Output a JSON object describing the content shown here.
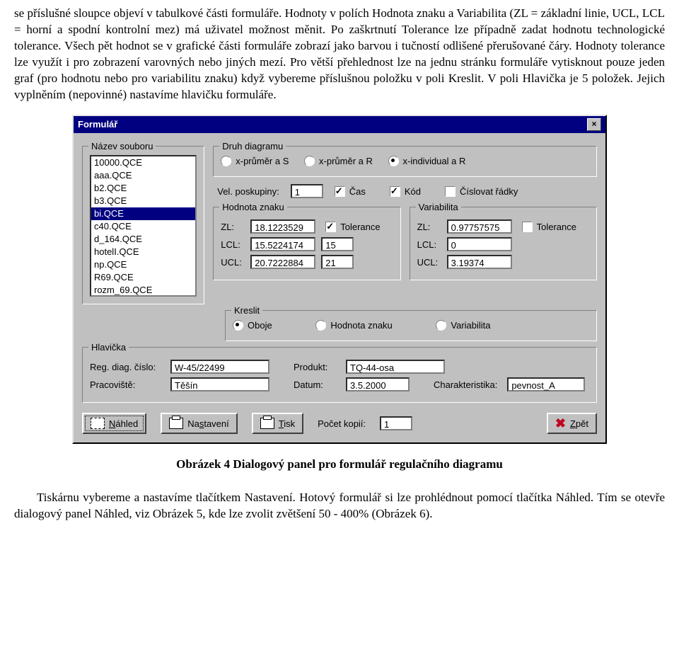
{
  "para1": "se příslušné sloupce objeví v tabulkové části formuláře. Hodnoty v polích Hodnota znaku a Variabilita (ZL = základní linie, UCL, LCL = horní a spodní kontrolní mez) má uživatel možnost měnit. Po zaškrtnutí Tolerance lze případně zadat hodnotu technologické tolerance. Všech pět hodnot se v grafické části formuláře zobrazí jako barvou i tučností odlišené přerušované čáry. Hodnoty tolerance lze využít i pro zobrazení varovných nebo jiných mezí. Pro větší přehlednost lze na jednu stránku formuláře vytisknout pouze jeden graf (pro hodnotu nebo pro variabilitu znaku) když vybereme příslušnou položku v poli Kreslit. V poli Hlavička je 5 položek. Jejich vyplněním (nepovinné) nastavíme hlavičku formuláře.",
  "dialog": {
    "title": "Formulář",
    "nazev_souboru": "Název souboru",
    "files": [
      "10000.QCE",
      "aaa.QCE",
      "b2.QCE",
      "b3.QCE",
      "bi.QCE",
      "c40.QCE",
      "d_164.QCE",
      "hotelI.QCE",
      "np.QCE",
      "R69.QCE",
      "rozm_69.QCE"
    ],
    "selected_index": 4,
    "druh": {
      "legend": "Druh diagramu",
      "opts": [
        "x-průměr a S",
        "x-průměr a R",
        "x-individual a R"
      ]
    },
    "vel_label": "Vel. poskupiny:",
    "vel_value": "1",
    "chk_cas": "Čas",
    "chk_kod": "Kód",
    "chk_cisl": "Číslovat řádky",
    "hz": {
      "legend": "Hodnota znaku",
      "zl": "ZL:",
      "zl_v": "18.1223529",
      "lcl": "LCL:",
      "lcl_v": "15.5224174",
      "lcl_tol": "15",
      "ucl": "UCL:",
      "ucl_v": "20.7222884",
      "ucl_tol": "21",
      "tol": "Tolerance"
    },
    "var": {
      "legend": "Variabilita",
      "zl": "ZL:",
      "zl_v": "0.97757575",
      "lcl": "LCL:",
      "lcl_v": "0",
      "ucl": "UCL:",
      "ucl_v": "3.19374",
      "tol": "Tolerance"
    },
    "kreslit": {
      "legend": "Kreslit",
      "opts": [
        "Oboje",
        "Hodnota znaku",
        "Variabilita"
      ]
    },
    "hlav": {
      "legend": "Hlavička",
      "reg": "Reg. diag. číslo:",
      "reg_v": "W-45/22499",
      "prod": "Produkt:",
      "prod_v": "TQ-44-osa",
      "prac": "Pracoviště:",
      "prac_v": "Těšín",
      "datum": "Datum:",
      "datum_v": "3.5.2000",
      "char": "Charakteristika:",
      "char_v": "pevnost_A"
    },
    "buttons": {
      "nahled_pre": "N",
      "nahled_post": "áhled",
      "nastav_pre": "Na",
      "nastav_mid": "s",
      "nastav_post": "tavení",
      "tisk_pre": "T",
      "tisk_post": "isk",
      "kopie": "Počet kopií:",
      "kopie_v": "1",
      "zpet_pre": "Z",
      "zpet_post": "pět"
    }
  },
  "caption": "Obrázek 4 Dialogový panel pro formulář regulačního diagramu",
  "para2": "Tiskárnu vybereme a nastavíme tlačítkem Nastavení. Hotový formulář si lze prohlédnout pomocí tlačítka Náhled. Tím se otevře dialogový panel Náhled, viz Obrázek 5, kde lze zvolit zvětšení 50 - 400% (Obrázek 6)."
}
